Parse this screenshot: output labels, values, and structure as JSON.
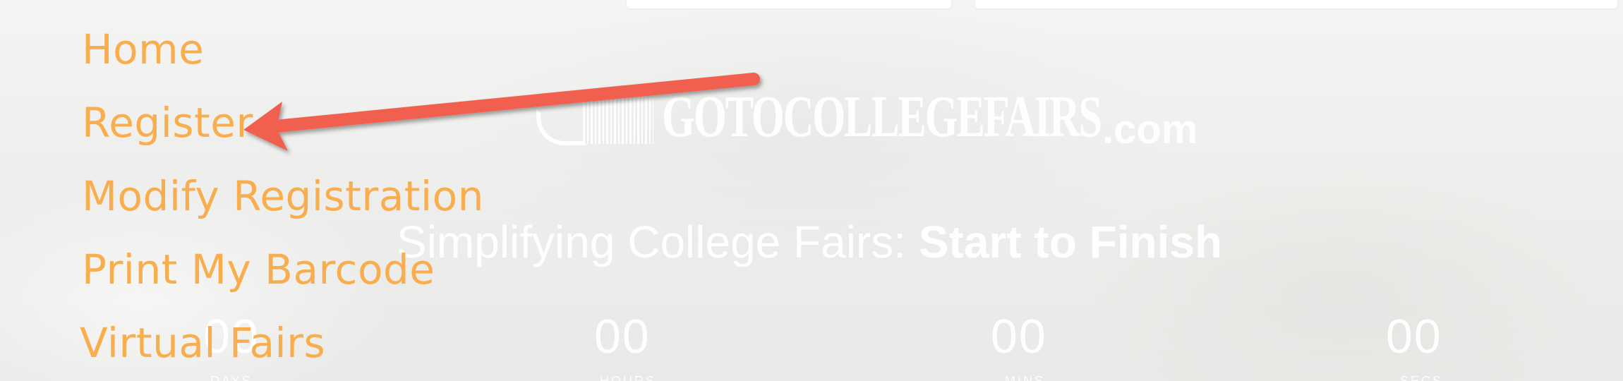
{
  "colors": {
    "menu_text": "#f8ae4f",
    "arrow": "#f15f4f",
    "background": "#f1f1ef",
    "overlay_text": "#ffffff"
  },
  "menu": {
    "items": [
      {
        "label": "Home"
      },
      {
        "label": "Register"
      },
      {
        "label": "Modify Registration"
      },
      {
        "label": "Print My Barcode"
      },
      {
        "label": "Virtual Fairs"
      }
    ]
  },
  "hero": {
    "logo_text": "GOTOCOLLEGEFAIRS",
    "logo_suffix": ".com",
    "tagline_light": "Simplifying College Fairs: ",
    "tagline_bold": "Start to Finish",
    "countdown": [
      {
        "value": "00",
        "label": "DAYS"
      },
      {
        "value": "00",
        "label": "HOURS"
      },
      {
        "value": "00",
        "label": "MINS"
      },
      {
        "value": "00",
        "label": "SECS"
      }
    ]
  },
  "annotation": {
    "arrow_target": "Register",
    "arrow_icon": "red-arrow-icon"
  }
}
